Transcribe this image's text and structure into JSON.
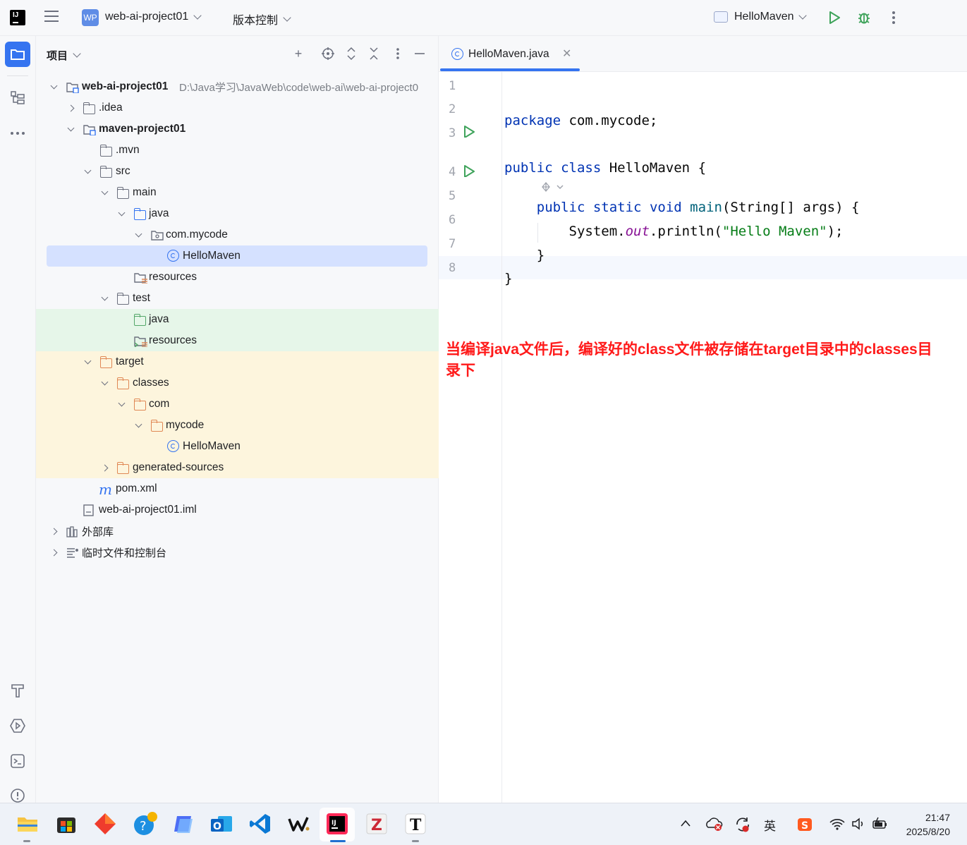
{
  "topbar": {
    "project_badge": "WP",
    "project_name": "web-ai-project01",
    "vcs_label": "版本控制",
    "run_config": "HelloMaven"
  },
  "left_toolbar": {
    "items": [
      "project-icon",
      "structure-icon",
      "more-icon",
      "build-icon",
      "services-icon",
      "terminal-icon",
      "problems-icon"
    ]
  },
  "project_panel": {
    "title": "项目",
    "tree": [
      {
        "label": "web-ai-project01",
        "path": "D:\\Java学习\\JavaWeb\\code\\web-ai\\web-ai-project0",
        "bold": true
      },
      {
        "label": ".idea"
      },
      {
        "label": "maven-project01",
        "bold": true
      },
      {
        "label": ".mvn"
      },
      {
        "label": "src"
      },
      {
        "label": "main"
      },
      {
        "label": "java"
      },
      {
        "label": "com.mycode"
      },
      {
        "label": "HelloMaven"
      },
      {
        "label": "resources"
      },
      {
        "label": "test"
      },
      {
        "label": "java"
      },
      {
        "label": "resources"
      },
      {
        "label": "target"
      },
      {
        "label": "classes"
      },
      {
        "label": "com"
      },
      {
        "label": "mycode"
      },
      {
        "label": "HelloMaven"
      },
      {
        "label": "generated-sources"
      },
      {
        "label": "pom.xml"
      },
      {
        "label": "web-ai-project01.iml"
      },
      {
        "label": "外部库"
      },
      {
        "label": "临时文件和控制台"
      }
    ]
  },
  "editor": {
    "tab_label": "HelloMaven.java",
    "line_numbers": [
      "1",
      "2",
      "3",
      "4",
      "5",
      "6",
      "7",
      "8"
    ],
    "code": {
      "l1_kw": "package",
      "l1_rest": " com.mycode;",
      "l3_kw1": "public",
      "l3_kw2": "class",
      "l3_rest": " HelloMaven {",
      "l4_kw1": "public",
      "l4_kw2": "static",
      "l4_kw3": "void",
      "l4_fn": "main",
      "l4_rest": "(String[] args) {",
      "l5_pre": "System.",
      "l5_static": "out",
      "l5_mid": ".println(",
      "l5_str": "\"Hello Maven\"",
      "l5_end": ");",
      "l6": "}",
      "l7": "}"
    },
    "annotation": "当编译java文件后，编译好的class文件被存储在target目录中的classes目录下"
  },
  "taskbar": {
    "ime_label": "英",
    "time": "21:47",
    "date": "2025/8/20"
  },
  "colors": {
    "accent": "#3574f0",
    "keyword": "#0033b3",
    "string": "#067d17",
    "annotation": "#ff1a1a",
    "test_bg": "#e6f6e9",
    "excluded_bg": "#fdf5dd"
  }
}
